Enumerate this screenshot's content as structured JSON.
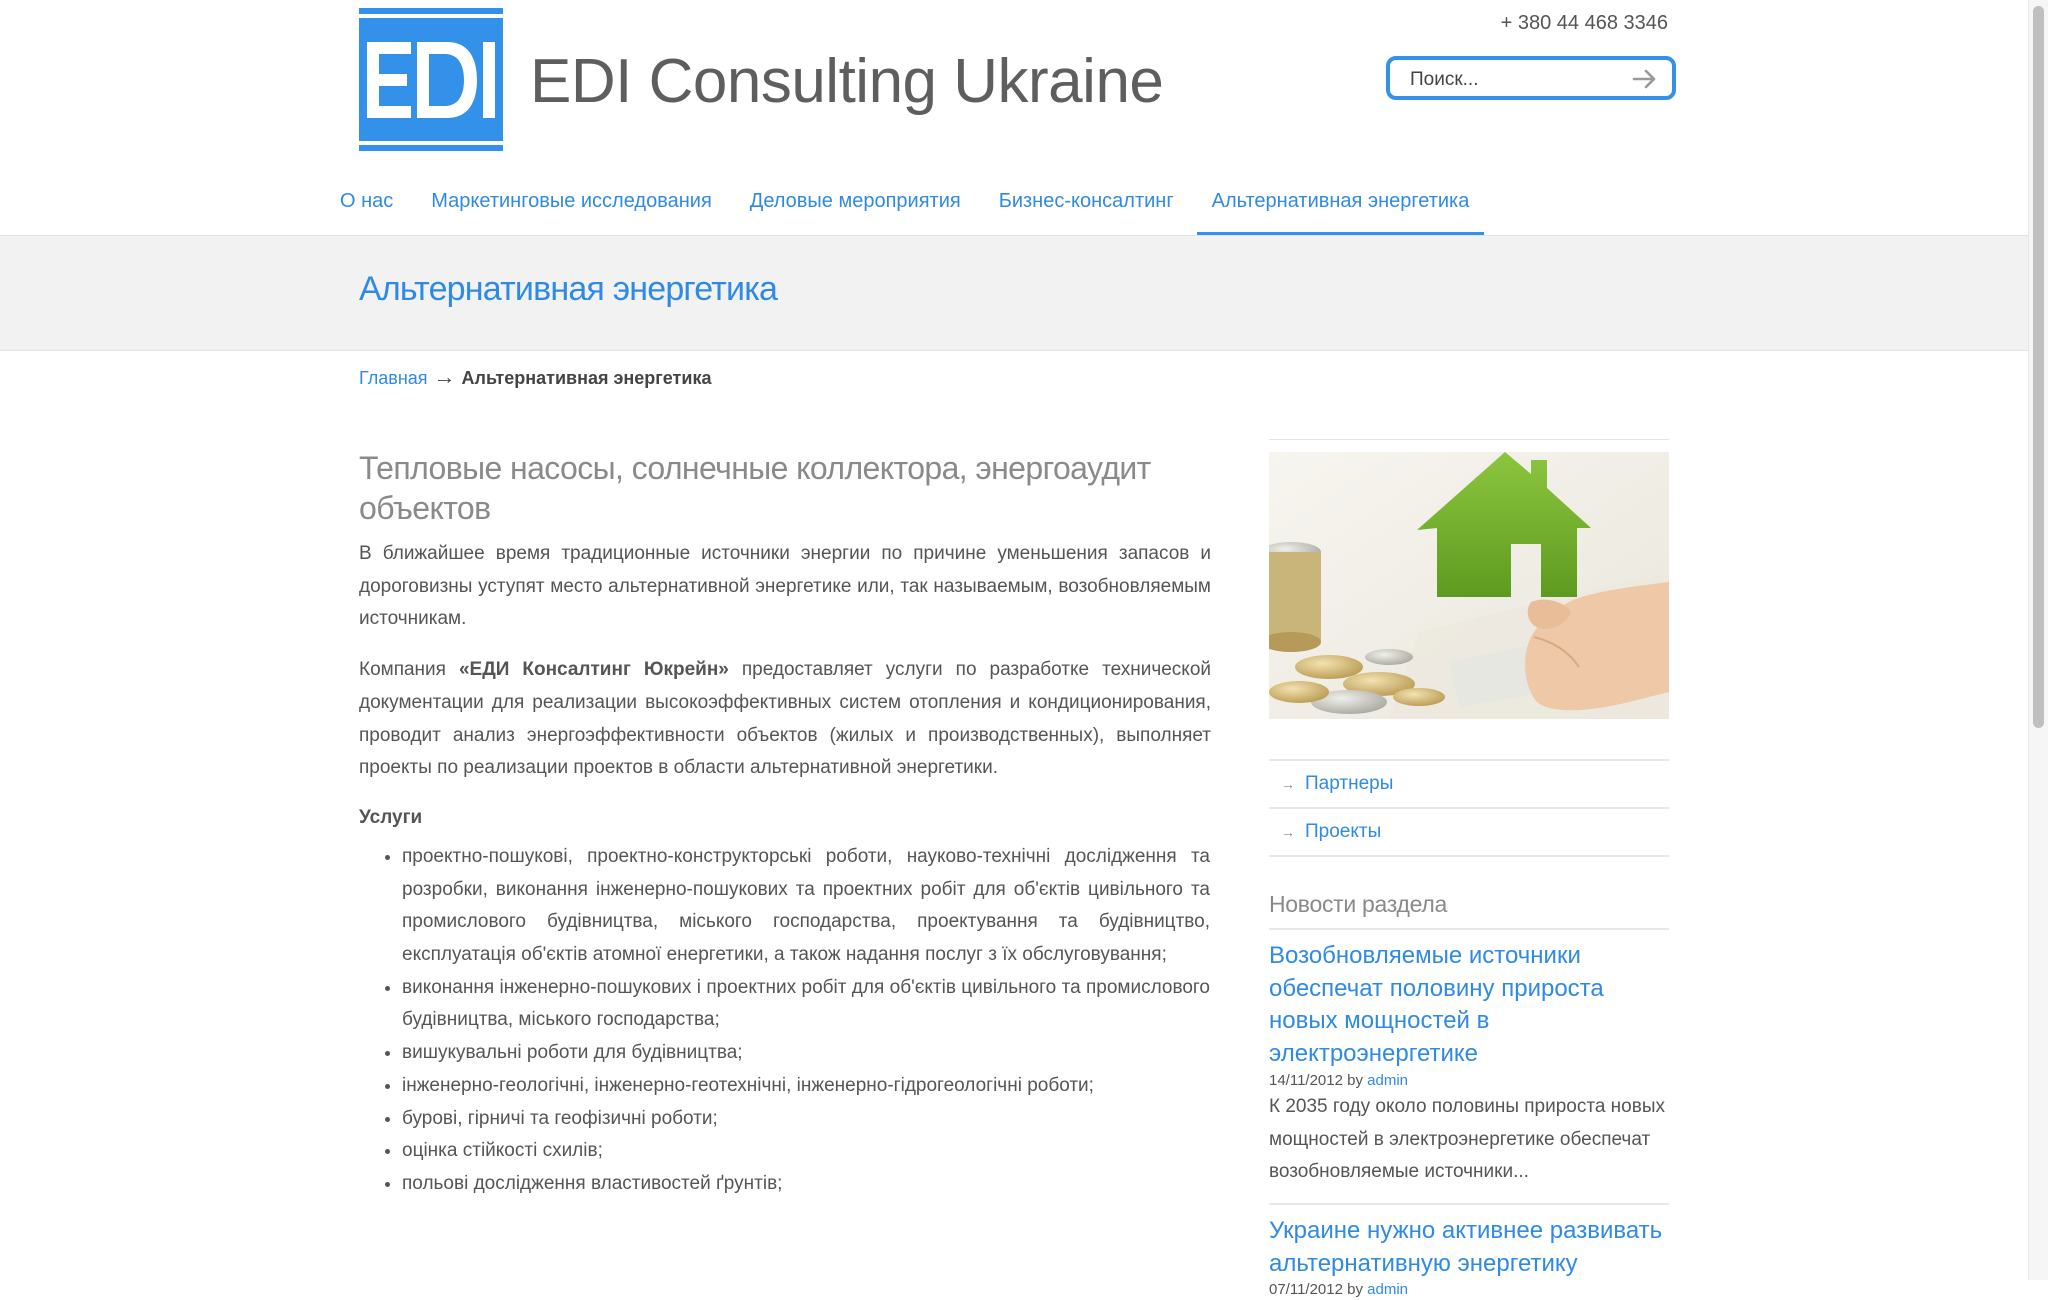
{
  "header": {
    "logo_text": "EDI",
    "site_title": "EDI Consulting Ukraine",
    "phone": "+ 380 44 468 3346",
    "search": {
      "placeholder": "Поиск..."
    }
  },
  "nav": {
    "items": [
      {
        "label": "О нас"
      },
      {
        "label": "Маркетинговые исследования"
      },
      {
        "label": "Деловые мероприятия"
      },
      {
        "label": "Бизнес-консалтинг"
      },
      {
        "label": "Альтернативная энергетика",
        "active": true
      }
    ]
  },
  "page": {
    "title": "Альтернативная энергетика",
    "breadcrumb": {
      "home": "Главная",
      "separator": "→",
      "current": "Альтернативная энергетика"
    }
  },
  "article": {
    "heading": "Тепловые насосы, солнечные коллектора, энергоаудит объектов",
    "p1": "В ближайшее время традиционные источники энергии по причине уменьшения запасов и дороговизны уступят место альтернативной энергетике или, так называемым, возобновляемым источникам.",
    "p2_before": "Компания ",
    "p2_bold": "«ЕДИ Консалтинг Юкрейн»",
    "p2_after": " предоставляет услуги по разработке технической документации для реализации высокоэффективных систем отопления и кондиционирования, проводит анализ энергоэффективности объектов (жилых и производственных), выполняет проекты по реализации проектов в области альтернативной энергетики.",
    "services_label": "Услуги",
    "services": [
      "проектно-пошукові, проектно-конструкторські роботи, науково-технічні дослідження та розробки, виконання інженерно-пошукових та проектних робіт для об'єктів цивільного та промислового будівництва, міського господарства, проектування та будівництво, експлуатація об'єктів атомної енергетики, а також надання послуг з їх обслуговування;",
      "виконання інженерно-пошукових і проектних робіт для об'єктів цивільного та промислового будівництва, міського господарства;",
      "вишукувальні роботи для будівництва;",
      "інженерно-геологічні, інженерно-геотехнічні, інженерно-гідрогеологічні роботи;",
      "бурові, гірничі та геофізичні роботи;",
      "оцінка стійкості схилів;",
      " польові дослідження властивостей ґрунтів;"
    ]
  },
  "sidebar": {
    "links": [
      {
        "label": "Партнеры"
      },
      {
        "label": "Проекты"
      }
    ],
    "news_title": "Новости раздела",
    "news": [
      {
        "title": "Возобновляемые источники обеспечат половину прироста новых мощностей в электроэнергетике",
        "date": "14/11/2012",
        "by": "by",
        "author": "admin",
        "excerpt": "К 2035 году около половины прироста новых мощностей в электроэнергетике обеспечат возобновляемые источники..."
      },
      {
        "title": "Украине нужно активнее развивать альтернативную энергетику",
        "date": "07/11/2012",
        "by": "by",
        "author": "admin"
      }
    ]
  },
  "colors": {
    "accent": "#3391ea",
    "link": "#2f8ae5",
    "text": "#555555",
    "band": "#f2f2f2"
  }
}
